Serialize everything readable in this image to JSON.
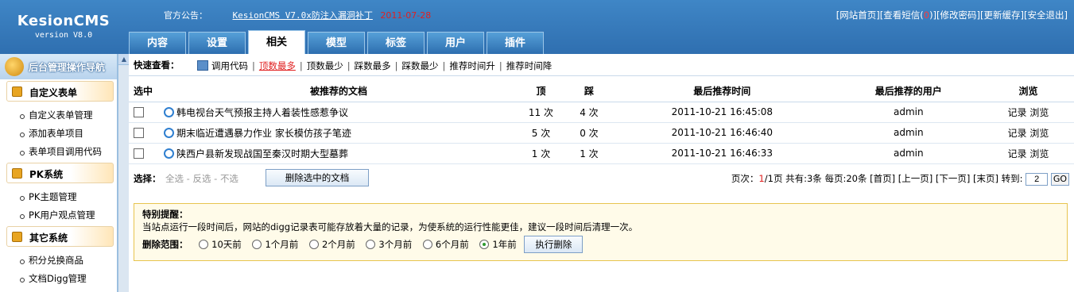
{
  "header": {
    "logo_name": "KesionCMS",
    "logo_version": "version V8.0",
    "notice_label": "官方公告：",
    "notice_link": "KesionCMS V7.0x防注入漏洞补丁",
    "notice_date": "2011-07-28",
    "top_links": [
      "[网站首页]",
      "[查看短信(",
      "0",
      ")]",
      "[修改密码]",
      "[更新缓存]",
      "[安全退出]"
    ]
  },
  "tabs": [
    "内容",
    "设置",
    "相关",
    "模型",
    "标签",
    "用户",
    "插件"
  ],
  "active_tab": "相关",
  "sidebar": {
    "title": "后台管理操作导航",
    "sections": [
      {
        "title": "自定义表单",
        "items": [
          "自定义表单管理",
          "添加表单项目",
          "表单项目调用代码"
        ]
      },
      {
        "title": "PK系统",
        "items": [
          "PK主题管理",
          "PK用户观点管理"
        ]
      },
      {
        "title": "其它系统",
        "items": [
          "积分兑换商品",
          "文档Digg管理"
        ]
      }
    ]
  },
  "quick": {
    "label": "快速查看：",
    "items": [
      "调用代码",
      "顶数最多",
      "顶数最少",
      "踩数最多",
      "踩数最少",
      "推荐时间升",
      "推荐时间降"
    ],
    "active_index": 1
  },
  "table": {
    "headers": [
      "选中",
      "被推荐的文档",
      "顶",
      "踩",
      "最后推荐时间",
      "最后推荐的用户",
      "浏览"
    ],
    "rows": [
      {
        "title": "韩电视台天气预报主持人着装性感惹争议",
        "up": "11 次",
        "down": "4 次",
        "time": "2011-10-21 16:45:08",
        "user": "admin",
        "record": "记录",
        "browse": "浏览"
      },
      {
        "title": "期末临近遭遇暴力作业 家长模仿孩子笔迹",
        "up": "5 次",
        "down": "0 次",
        "time": "2011-10-21 16:46:40",
        "user": "admin",
        "record": "记录",
        "browse": "浏览"
      },
      {
        "title": "陕西户县新发现战国至秦汉时期大型墓葬",
        "up": "1 次",
        "down": "1 次",
        "time": "2011-10-21 16:46:33",
        "user": "admin",
        "record": "记录",
        "browse": "浏览"
      }
    ]
  },
  "bar": {
    "select_label": "选择：",
    "select_links": [
      "全选",
      "反选",
      "不选"
    ],
    "delete_button": "删除选中的文档",
    "pager_prefix": "页次：",
    "page_current": "1",
    "pager_rest": "/1页 共有:3条 每页:20条 [首页] [上一页] [下一页] [末页] 转到:",
    "goto_value": "2",
    "go_label": "GO"
  },
  "remind": {
    "title": "特别提醒：",
    "text": "当站点运行一段时间后，网站的digg记录表可能存放着大量的记录，为使系统的运行性能更佳，建议一段时间后清理一次。",
    "range_label": "删除范围：",
    "options": [
      "10天前",
      "1个月前",
      "2个月前",
      "3个月前",
      "6个月前",
      "1年前"
    ],
    "selected_index": 5,
    "exec_button": "执行删除"
  }
}
